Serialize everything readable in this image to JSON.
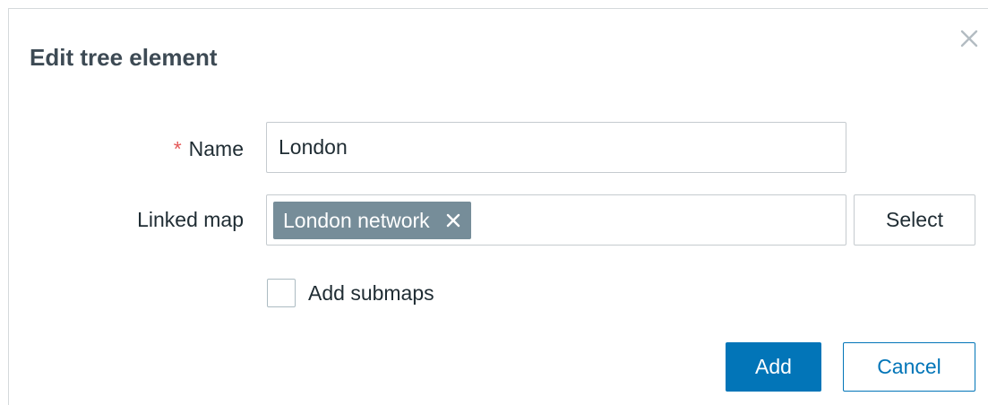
{
  "dialog": {
    "title": "Edit tree element",
    "close_icon": "close-icon"
  },
  "form": {
    "name": {
      "required_mark": "*",
      "label": "Name",
      "value": "London"
    },
    "linked_map": {
      "label": "Linked map",
      "selected": [
        {
          "label": "London network",
          "remove_icon": "close-icon"
        }
      ],
      "select_button": "Select"
    },
    "add_submaps": {
      "label": "Add submaps",
      "checked": false
    }
  },
  "footer": {
    "add_label": "Add",
    "cancel_label": "Cancel"
  },
  "colors": {
    "primary": "#0275b8",
    "tag_background": "#768d99",
    "required": "#e45959",
    "title": "#3d4a54"
  }
}
